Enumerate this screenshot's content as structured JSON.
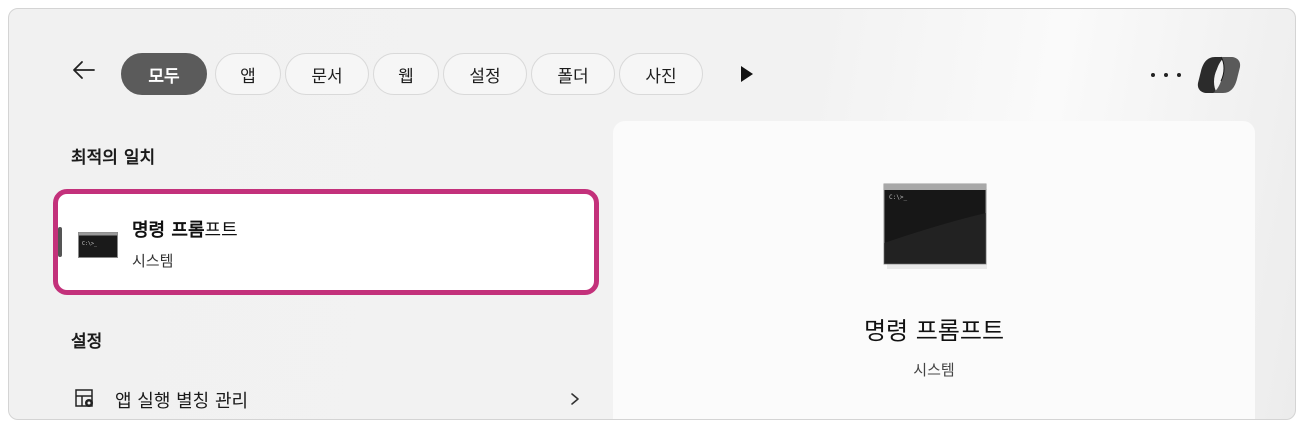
{
  "filters": {
    "tabs": [
      {
        "label": "모두",
        "active": true
      },
      {
        "label": "앱"
      },
      {
        "label": "문서"
      },
      {
        "label": "웹"
      },
      {
        "label": "설정"
      },
      {
        "label": "폴더"
      },
      {
        "label": "사진"
      }
    ]
  },
  "best_match": {
    "heading": "최적의 일치",
    "item": {
      "title_bold": "명령 프롬",
      "title_rest": "프트",
      "subtitle": "시스템",
      "icon": "command-prompt-icon"
    }
  },
  "settings": {
    "heading": "설정",
    "items": [
      {
        "label": "앱 실행 별칭 관리",
        "icon": "app-alias-icon"
      }
    ]
  },
  "preview": {
    "title": "명령 프롬프트",
    "subtitle": "시스템",
    "icon": "command-prompt-large-icon"
  },
  "colors": {
    "highlight_border": "#c3317b",
    "active_chip": "#5b5b5b"
  }
}
